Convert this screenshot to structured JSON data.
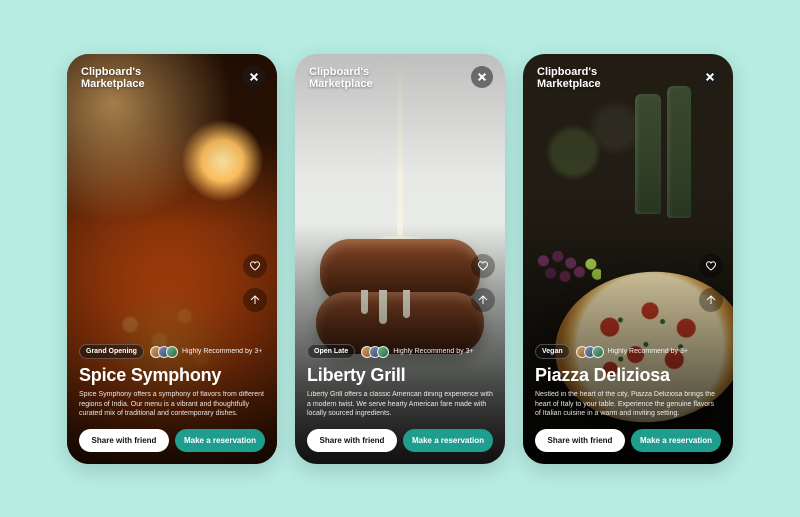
{
  "brand_line1": "Clipboard's",
  "brand_line2": "Marketplace",
  "buttons": {
    "share": "Share with friend",
    "reserve": "Make a reservation"
  },
  "recommend_text": "Highly Recommend by 3+",
  "cards": [
    {
      "badge": "Grand Opening",
      "title": "Spice Symphony",
      "description": "Spice Symphony offers a symphony of flavors from different regions of India. Our menu is a vibrant and thoughtfully curated mix of traditional and contemporary dishes."
    },
    {
      "badge": "Open Late",
      "title": "Liberty Grill",
      "description": "Liberty Grill offers a classic American dining experience with a modern twist. We serve hearty American fare made with locally sourced ingredients."
    },
    {
      "badge": "Vegan",
      "title": "Piazza Deliziosa",
      "description": "Nestled in the heart of the city, Piazza Deliziosa brings the heart of Italy to your table. Experience the genuine flavors of Italian cuisine in a warm and inviting setting."
    }
  ]
}
